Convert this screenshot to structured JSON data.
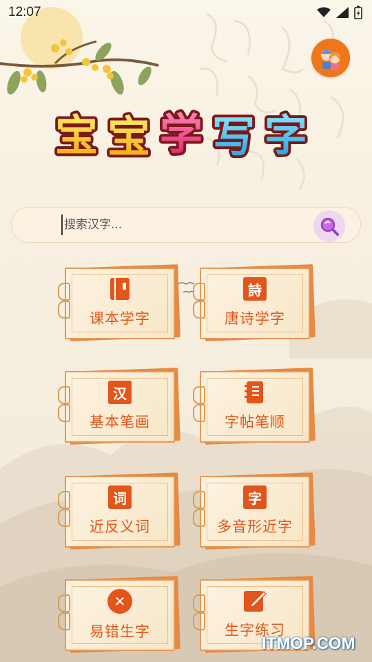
{
  "status_bar": {
    "time": "12:07"
  },
  "logo": {
    "text": "宝宝学写字"
  },
  "search": {
    "placeholder": "搜索汉字..."
  },
  "menu": {
    "items": [
      {
        "label": "课本学字",
        "icon": "book-icon",
        "glyph": ""
      },
      {
        "label": "唐诗学字",
        "icon": "poem-icon",
        "glyph": "詩"
      },
      {
        "label": "基本笔画",
        "icon": "stroke-icon",
        "glyph": "汉"
      },
      {
        "label": "字帖笔顺",
        "icon": "notebook-icon",
        "glyph": ""
      },
      {
        "label": "近反义词",
        "icon": "word-icon",
        "glyph": "词"
      },
      {
        "label": "多音形近字",
        "icon": "character-icon",
        "glyph": "字"
      },
      {
        "label": "易错生字",
        "icon": "close-circle-icon",
        "glyph": "✕"
      },
      {
        "label": "生字练习",
        "icon": "edit-icon",
        "glyph": ""
      }
    ]
  },
  "watermark": {
    "text": "ITMOP.COM"
  },
  "colors": {
    "accent": "#e0551a",
    "card_border": "#e79857",
    "avatar_bg": "#f0761a"
  }
}
